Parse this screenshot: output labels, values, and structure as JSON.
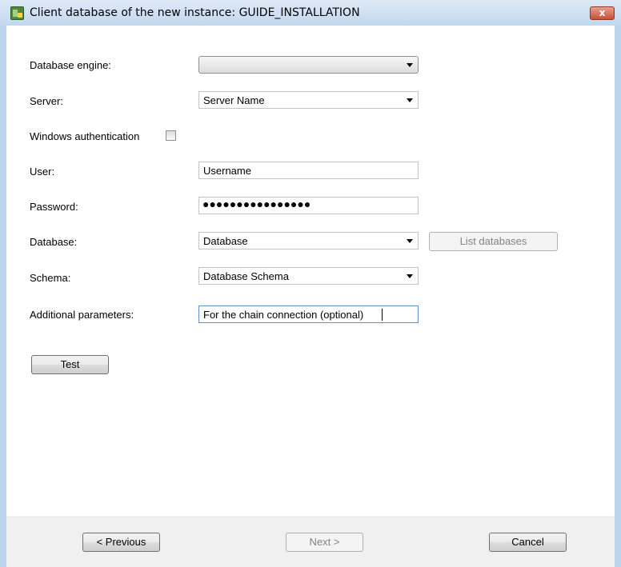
{
  "window": {
    "title": "Client database of the new instance: GUIDE_INSTALLATION",
    "close_glyph": "x"
  },
  "form": {
    "engine": {
      "label": "Database engine:",
      "value": ""
    },
    "server": {
      "label": "Server:",
      "value": "Server Name"
    },
    "windows_auth": {
      "label": "Windows authentication",
      "checked": false
    },
    "user": {
      "label": "User:",
      "value": "Username"
    },
    "password": {
      "label": "Password:",
      "masked_value": "●●●●●●●●●●●●●●●●"
    },
    "database": {
      "label": "Database:",
      "value": "Database",
      "list_button": "List databases"
    },
    "schema": {
      "label": "Schema:",
      "value": "Database Schema"
    },
    "additional": {
      "label": "Additional parameters:",
      "value": "For the chain connection (optional)"
    },
    "test_button": "Test"
  },
  "footer": {
    "previous": "< Previous",
    "next": "Next >",
    "cancel": "Cancel"
  },
  "icons": {
    "app": "database-app-icon",
    "close": "close-icon",
    "dropdown": "chevron-down-icon"
  }
}
